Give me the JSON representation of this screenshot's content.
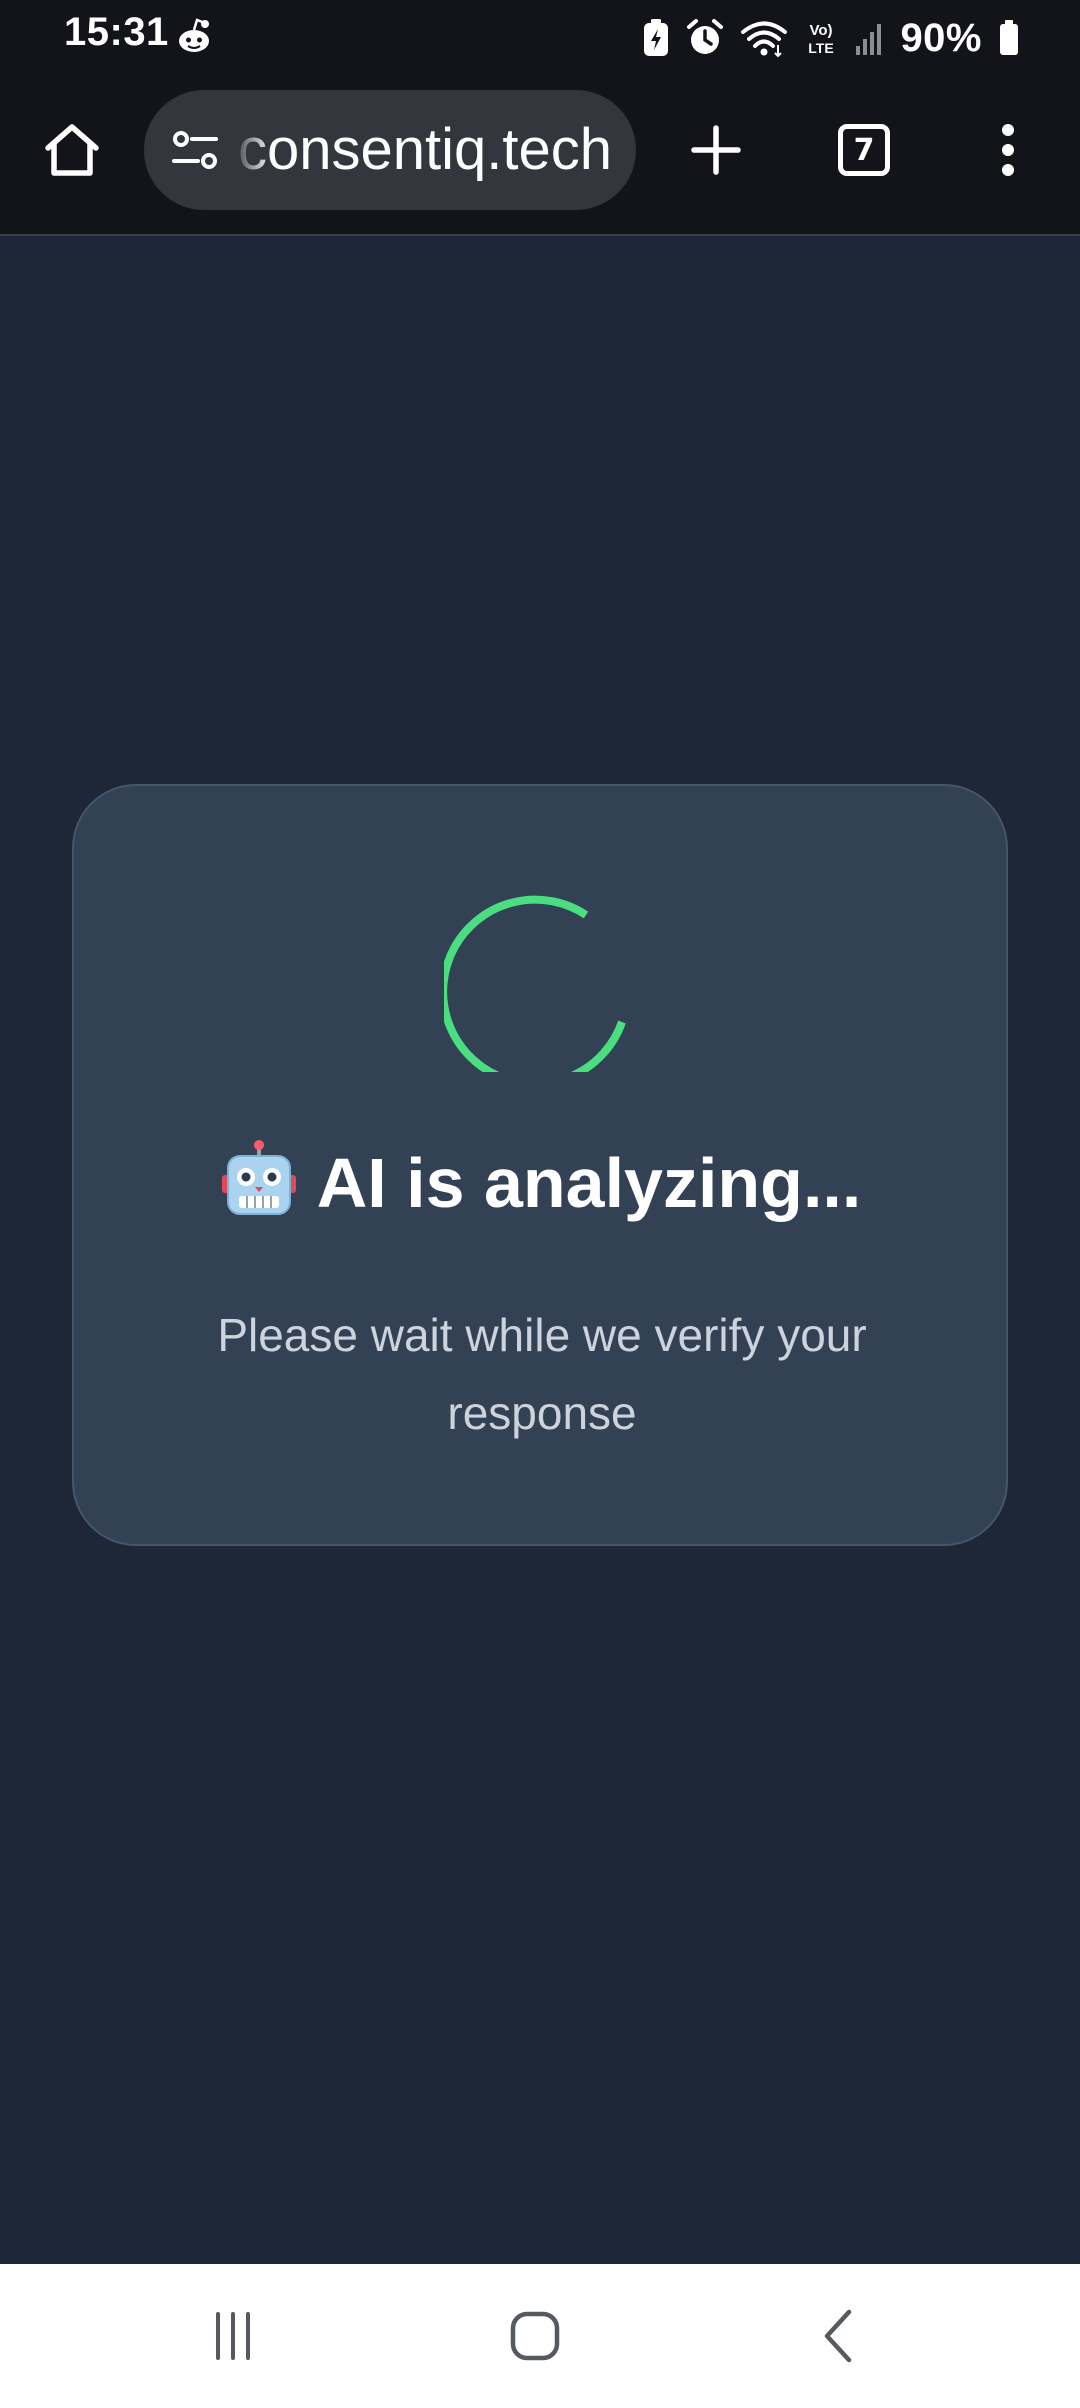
{
  "status_bar": {
    "time": "15:31",
    "battery": "90%",
    "icons": [
      "reddit-icon",
      "battery-saver-icon",
      "alarm-icon",
      "wifi-icon",
      "volte-icon",
      "signal-icon",
      "battery-icon"
    ]
  },
  "browser": {
    "url": "consentiq.tech",
    "tab_count": "7",
    "icons": [
      "home-icon",
      "site-settings-icon",
      "plus-icon",
      "tabs-icon",
      "more-vert-icon"
    ]
  },
  "card": {
    "emoji": "robot-face",
    "title": "AI is analyzing...",
    "subtitle": "Please wait while we verify your response",
    "spinner_color": "#4ade80"
  },
  "nav_bar": {
    "icons": [
      "recents-icon",
      "home-nav-icon",
      "back-icon"
    ]
  },
  "colors": {
    "page_bg": "#1e2738",
    "card_bg": "#334154",
    "chrome_bg": "#121419",
    "accent": "#4ade80"
  }
}
